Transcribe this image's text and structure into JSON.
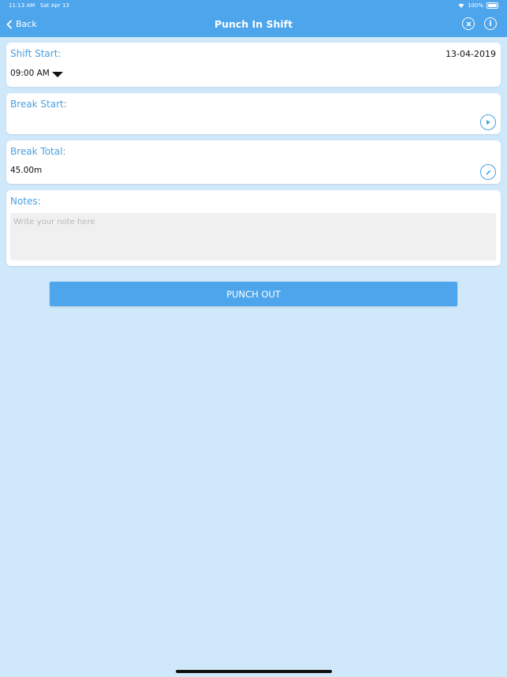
{
  "status_bar": {
    "time": "11:13 AM",
    "date": "Sat Apr 13",
    "battery": "100%"
  },
  "nav": {
    "back_label": "Back",
    "title": "Punch In Shift",
    "close_icon": "close-circle-icon",
    "info_icon": "info-icon",
    "info_glyph": "i"
  },
  "shift_start": {
    "label": "Shift Start:",
    "time": "09:00 AM",
    "date": "13-04-2019"
  },
  "break_start": {
    "label": "Break Start:",
    "value": ""
  },
  "break_total": {
    "label": "Break Total:",
    "value": "45.00m"
  },
  "notes": {
    "label": "Notes:",
    "placeholder": "Write your note here"
  },
  "punch_button": {
    "label": "PUNCH OUT"
  },
  "colors": {
    "accent": "#4da5ec",
    "label": "#4a9fe0",
    "background": "#cfe8fa"
  }
}
